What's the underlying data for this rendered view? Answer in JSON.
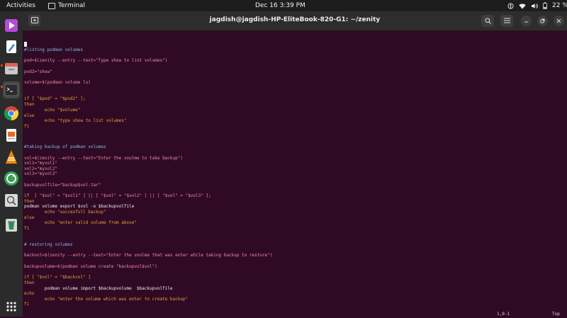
{
  "topbar": {
    "activities": "Activities",
    "app_name": "Terminal",
    "clock": "Dec 16  3:39 PM",
    "battery": "22 %"
  },
  "window": {
    "title": "jagdish@jagdish-HP-EliteBook-820-G1: ~/zenity"
  },
  "dock": {
    "items": [
      "app-center",
      "text-editor",
      "files",
      "terminal",
      "chrome",
      "libreoffice-impress",
      "vlc",
      "software-updater",
      "screenshot-viewer",
      "trash",
      "show-apps"
    ]
  },
  "editor": {
    "lines": [
      {
        "t": "#listing podman volumes"
      },
      {
        "t": "pod=$(zenity --entry --text=\"Type show to list volumes\")"
      },
      {
        "t": "pod2=\"show\""
      },
      {
        "t": "volume=$(podman volume ls)"
      },
      {
        "t": "if [ \"$pod\" = \"$pod2\" ];"
      },
      {
        "t": "then"
      },
      {
        "t": "        echo \"$volume\""
      },
      {
        "t": "else"
      },
      {
        "t": "        echo \"type show to list volumes\""
      },
      {
        "t": "fi"
      },
      {
        "t": "#taking backup of podman volumes"
      },
      {
        "t": "vol=$(zenity --entry --text=\"Enter the voulme to take backup\")"
      },
      {
        "t": "vol1=\"myvol1\""
      },
      {
        "t": "vol2=\"myvol2\""
      },
      {
        "t": "vol3=\"myvol3\""
      },
      {
        "t": "backupvolfile=\"backup$vol.tar\""
      },
      {
        "t": "if  [ \"$vol\" = \"$vol1\" ] || [ \"$vol\" = \"$vol2\" ] || [ \"$vol\" = \"$vol3\" ];"
      },
      {
        "t": "then"
      },
      {
        "t": "podman volume export $vol -o $backupvolfile"
      },
      {
        "t": "        echo \"succesfull backup\""
      },
      {
        "t": "else"
      },
      {
        "t": "        echo \"enter valid volume from above\""
      },
      {
        "t": "fi"
      },
      {
        "t": "# restoring volumes"
      },
      {
        "t": "backvol=$(zenity --entry --text=\"Enter the voulme that was enter while taking backup to restore\")"
      },
      {
        "t": "backupvolume=$(podman volume create \"backupvol$vol\")"
      },
      {
        "t": "if [ \"$vol\" = \"$backvol\" ]"
      },
      {
        "t": "then"
      },
      {
        "t": "        podman volume import $backupvolume  $backupvolfile"
      },
      {
        "t": "echo"
      },
      {
        "t": "        echo \"enter the volume which was enter to create backup\""
      },
      {
        "t": "fi"
      }
    ],
    "status_position": "1,0-1",
    "status_scroll": "Top"
  }
}
